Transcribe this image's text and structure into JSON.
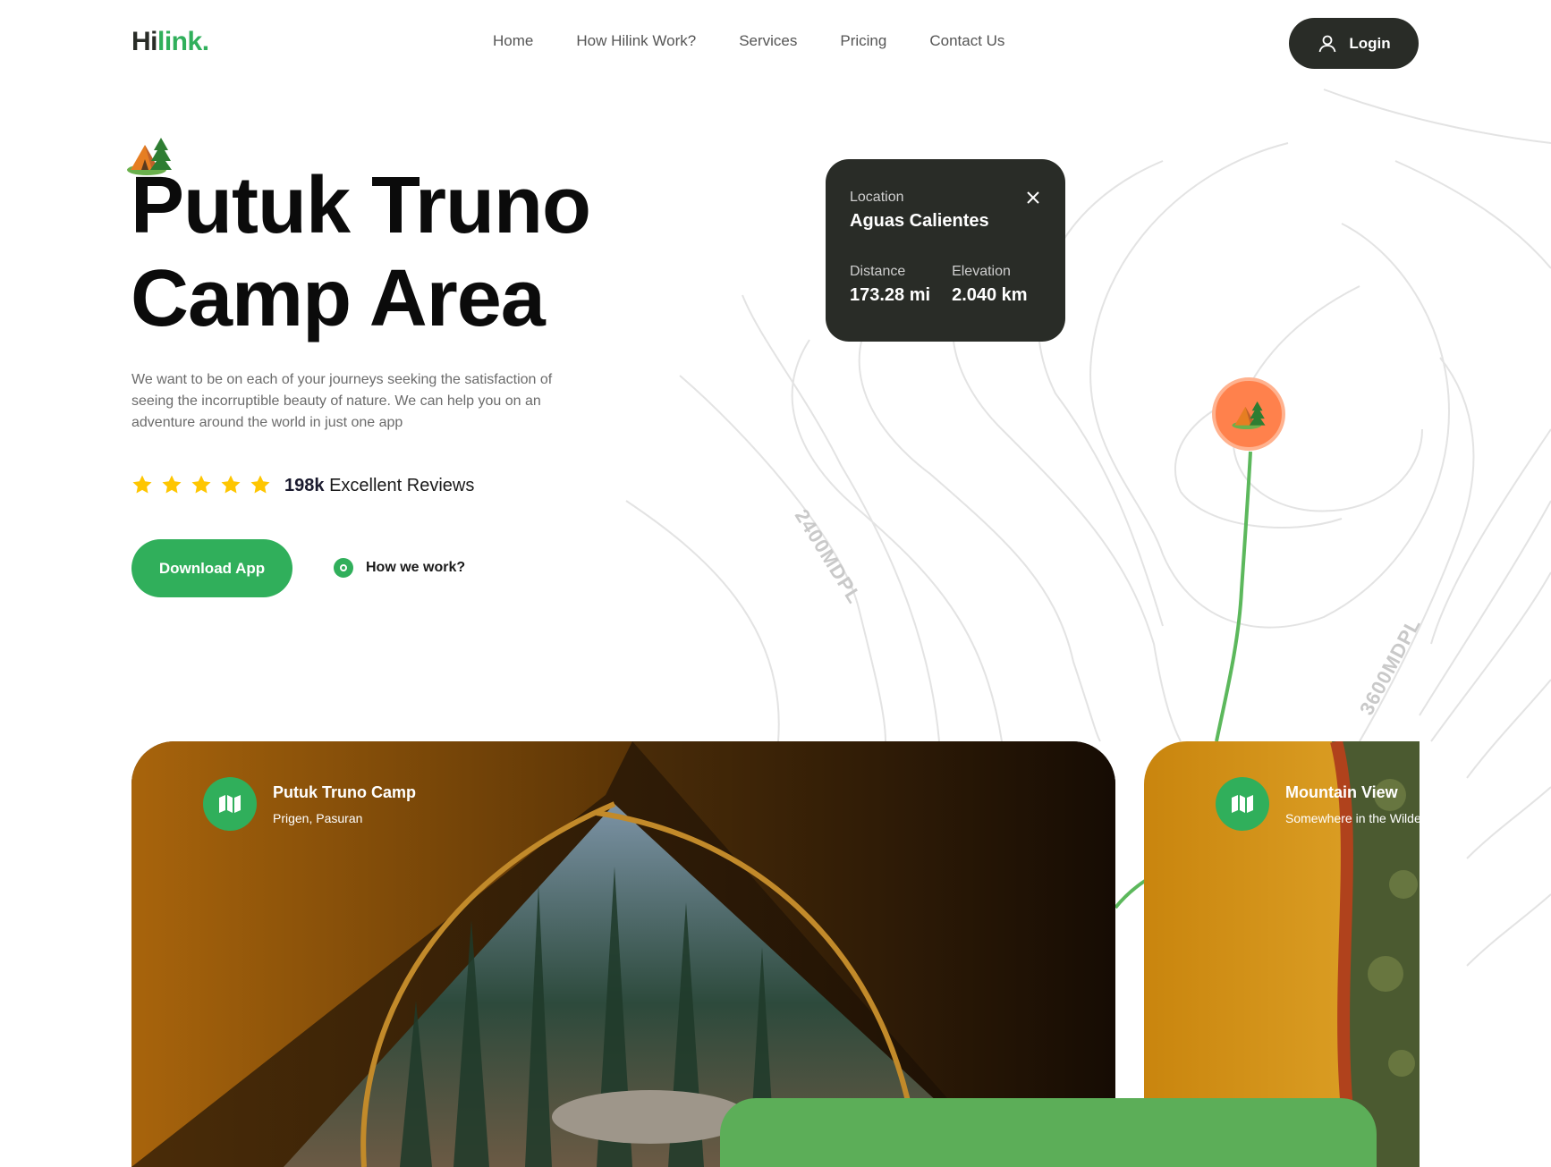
{
  "brand": {
    "logo_part1": "Hi",
    "logo_part2": "link",
    "logo_dot": "."
  },
  "nav": {
    "items": [
      {
        "label": "Home"
      },
      {
        "label": "How Hilink Work?"
      },
      {
        "label": "Services"
      },
      {
        "label": "Pricing"
      },
      {
        "label": "Contact Us"
      }
    ],
    "login_label": "Login",
    "login_icon": "user-icon"
  },
  "hero": {
    "title_line1": "Putuk Truno",
    "title_line2": "Camp Area",
    "description": "We want to be on each of your journeys seeking the satisfaction of seeing the incorruptible beauty of nature. We can help you on an adventure around the world in just one app",
    "rating": {
      "stars": 5,
      "count": "198k",
      "label": "Excellent Reviews"
    },
    "download_label": "Download App",
    "how_label": "How we work?"
  },
  "location_card": {
    "location_label": "Location",
    "location_value": "Aguas Calientes",
    "distance_label": "Distance",
    "distance_value": "173.28 mi",
    "elevation_label": "Elevation",
    "elevation_value": "2.040 km"
  },
  "map": {
    "contour_labels": [
      "2400MDPL",
      "3600MDPL"
    ]
  },
  "cards": [
    {
      "title": "Putuk Truno Camp",
      "subtitle": "Prigen, Pasuran"
    },
    {
      "title": "Mountain View",
      "subtitle": "Somewhere in the Wilderness"
    }
  ],
  "colors": {
    "accent_green": "#30af5b",
    "dark": "#292c27",
    "pin_orange": "#ff814c",
    "star": "#fec601"
  }
}
